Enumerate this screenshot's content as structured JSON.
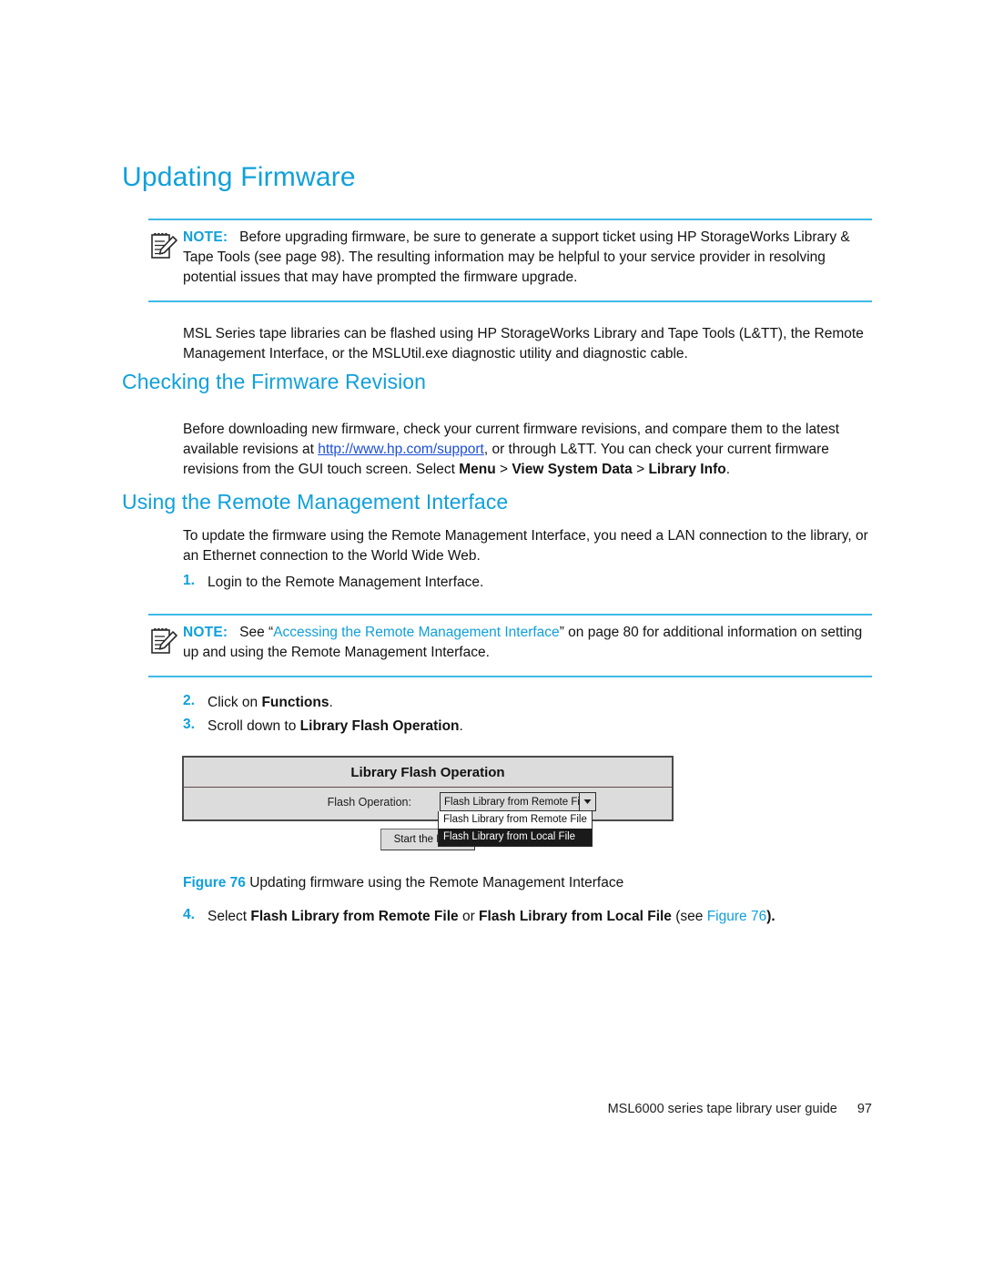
{
  "document": {
    "title": "Updating Firmware",
    "footer_text": "MSL6000 series tape library user guide",
    "page_number": "97"
  },
  "colors": {
    "heading_blue": "#10A0DB",
    "rule_blue": "#3FB9E5",
    "link_blue": "#1d4fd8",
    "dialog_gray": "#dcdcdc",
    "dialog_border": "#4a4a4a",
    "highlight_black": "#1a1a1a"
  },
  "notes": [
    {
      "label": "NOTE:",
      "text_before": "Before upgrading firmware, be sure to generate a support ticket using HP StorageWorks Library & Tape Tools (see page 98). The resulting information may be helpful to your service provider in resolving potential issues that may have prompted the firmware upgrade."
    },
    {
      "label": "NOTE:",
      "lead": "See “",
      "link": "Accessing the Remote Management Interface",
      "tail": "” on page 80 for additional information on setting up and using the Remote Management Interface."
    }
  ],
  "intro_paragraph": "MSL Series tape libraries can be flashed using HP StorageWorks Library and Tape Tools (L&TT), the Remote Management Interface, or the MSLUtil.exe diagnostic utility and diagnostic cable.",
  "sections": [
    {
      "heading": "Checking the Firmware Revision",
      "paragraph_part1": "Before downloading new firmware, check your current firmware revisions, and compare them to the latest available revisions at ",
      "link_text": "http://www.hp.com/support",
      "paragraph_part2": ", or through L&TT. You can check your current firmware revisions from the GUI touch screen. Select ",
      "menu_1": "Menu",
      "sep_1": " > ",
      "menu_2": "View System Data",
      "sep_2": " > ",
      "menu_3": "Library Info",
      "paragraph_end": "."
    },
    {
      "heading": "Using the Remote Management Interface",
      "paragraph": "To update the firmware using the Remote Management Interface, you need a LAN connection to the library, or an Ethernet connection to the World Wide Web."
    }
  ],
  "steps": [
    {
      "num": "1.",
      "text": "Login to the Remote Management Interface."
    },
    {
      "num": "2.",
      "prefix": "Click on ",
      "bold": "Functions",
      "suffix": "."
    },
    {
      "num": "3.",
      "prefix": "Scroll down to ",
      "bold": "Library Flash Operation",
      "suffix": "."
    },
    {
      "num": "4.",
      "prefix": "Select ",
      "bold1": "Flash Library from Remote File",
      "mid": " or ",
      "bold2": "Flash Library from Local File",
      "suffix": " (see ",
      "figref": "Figure 76",
      "end": ")."
    }
  ],
  "figure": {
    "caption_number": "Figure 76",
    "caption_text": "Updating firmware using the Remote Management Interface",
    "dialog": {
      "title": "Library Flash Operation",
      "field_label": "Flash Operation:",
      "selected_value": "Flash Library from Remote File",
      "options": [
        {
          "label": "Flash Library from Remote File",
          "highlighted": false
        },
        {
          "label": "Flash Library from Local File",
          "highlighted": true
        }
      ],
      "button_label": "Start the Flash"
    }
  }
}
